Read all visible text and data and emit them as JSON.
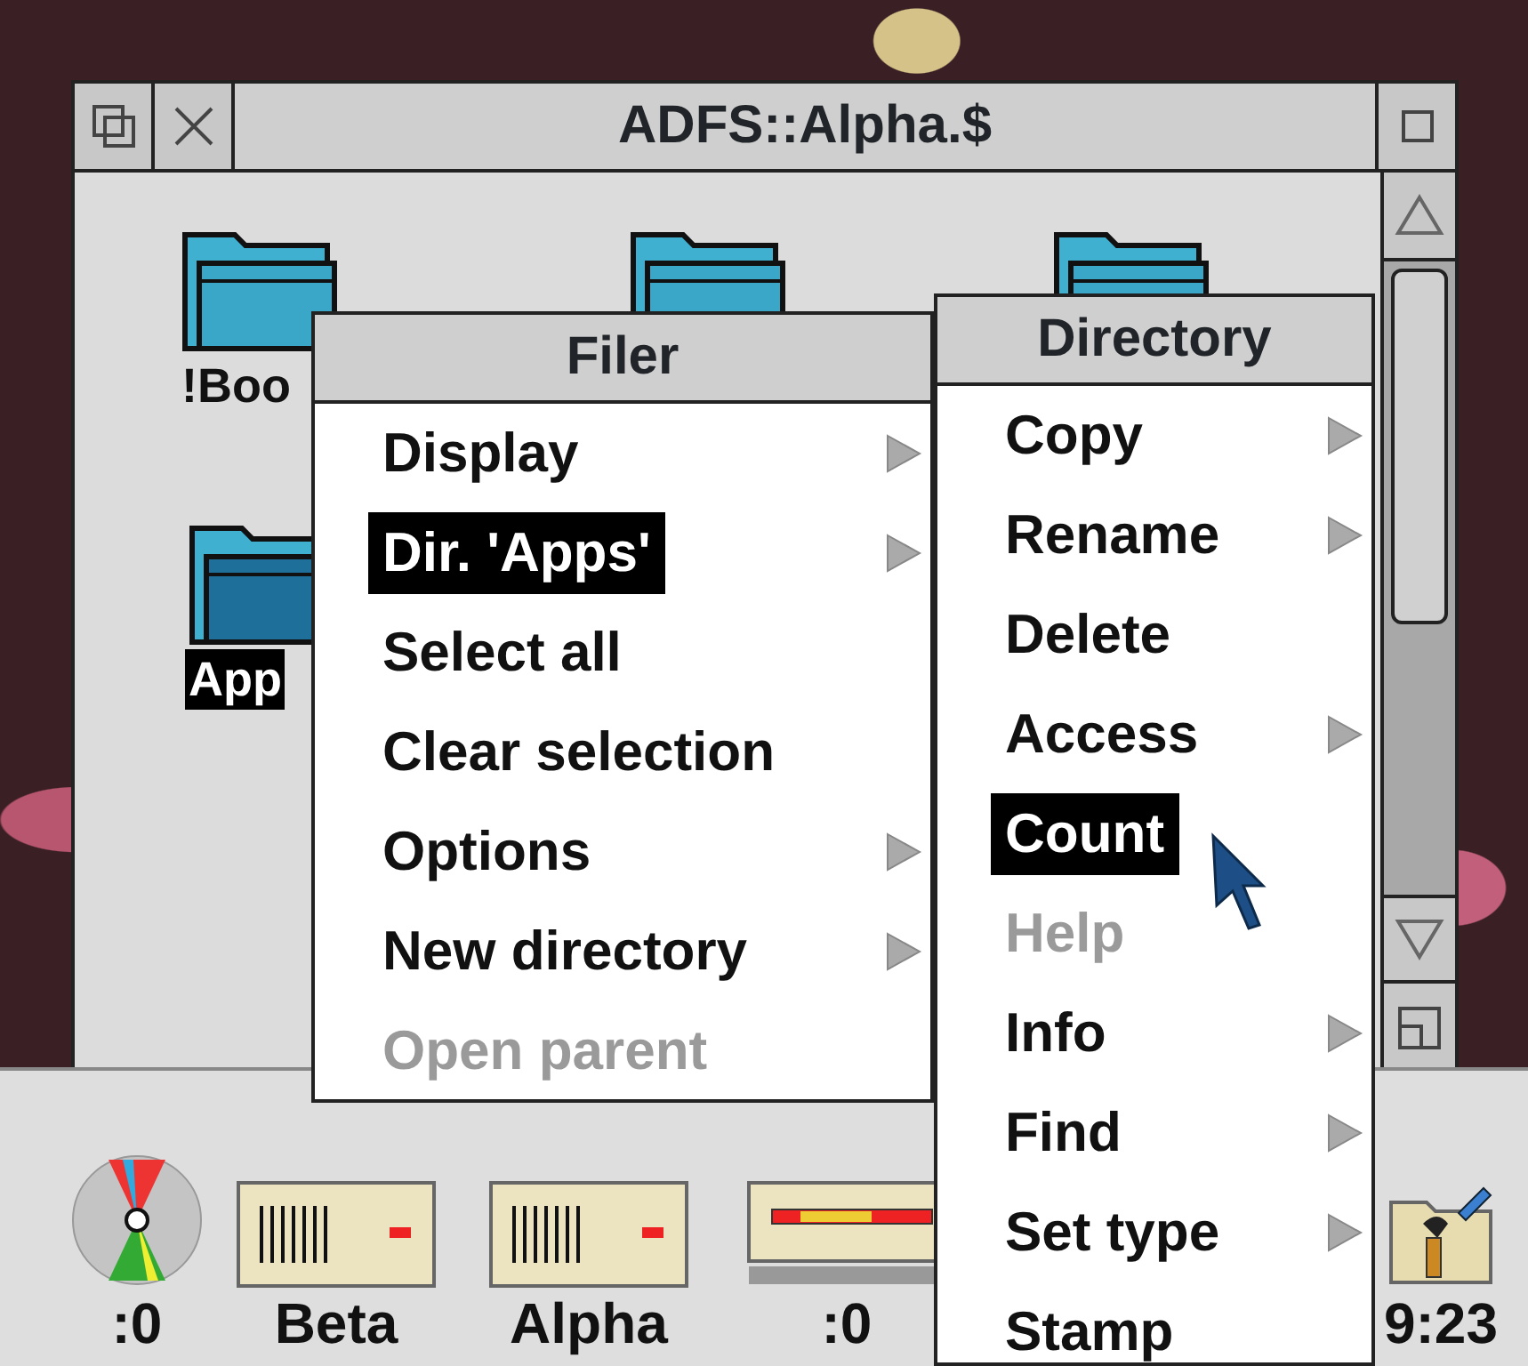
{
  "window": {
    "title": "ADFS::Alpha.$",
    "icons": [
      {
        "label": "!Boo",
        "selected": false
      },
      {
        "label": "App",
        "selected": true
      }
    ]
  },
  "filer_menu": {
    "title": "Filer",
    "items": [
      {
        "label": "Display",
        "selected": false,
        "disabled": false,
        "submenu": true
      },
      {
        "label": "Dir. 'Apps'",
        "selected": true,
        "disabled": false,
        "submenu": true
      },
      {
        "label": "Select all",
        "selected": false,
        "disabled": false,
        "submenu": false
      },
      {
        "label": "Clear selection",
        "selected": false,
        "disabled": false,
        "submenu": false
      },
      {
        "label": "Options",
        "selected": false,
        "disabled": false,
        "submenu": true
      },
      {
        "label": "New directory",
        "selected": false,
        "disabled": false,
        "submenu": true
      },
      {
        "label": "Open parent",
        "selected": false,
        "disabled": true,
        "submenu": false
      }
    ]
  },
  "directory_menu": {
    "title": "Directory",
    "items": [
      {
        "label": "Copy",
        "selected": false,
        "disabled": false,
        "submenu": true
      },
      {
        "label": "Rename",
        "selected": false,
        "disabled": false,
        "submenu": true
      },
      {
        "label": "Delete",
        "selected": false,
        "disabled": false,
        "submenu": false
      },
      {
        "label": "Access",
        "selected": false,
        "disabled": false,
        "submenu": true
      },
      {
        "label": "Count",
        "selected": true,
        "disabled": false,
        "submenu": false
      },
      {
        "label": "Help",
        "selected": false,
        "disabled": true,
        "submenu": false
      },
      {
        "label": "Info",
        "selected": false,
        "disabled": false,
        "submenu": true
      },
      {
        "label": "Find",
        "selected": false,
        "disabled": false,
        "submenu": true
      },
      {
        "label": "Set type",
        "selected": false,
        "disabled": false,
        "submenu": true
      },
      {
        "label": "Stamp",
        "selected": false,
        "disabled": false,
        "submenu": false
      }
    ]
  },
  "icon_bar": {
    "items": [
      {
        "label": ":0",
        "kind": "cd"
      },
      {
        "label": "Beta",
        "kind": "harddisc"
      },
      {
        "label": "Alpha",
        "kind": "harddisc"
      },
      {
        "label": ":0",
        "kind": "floppy"
      },
      {
        "label": "9:23",
        "kind": "app"
      }
    ]
  }
}
